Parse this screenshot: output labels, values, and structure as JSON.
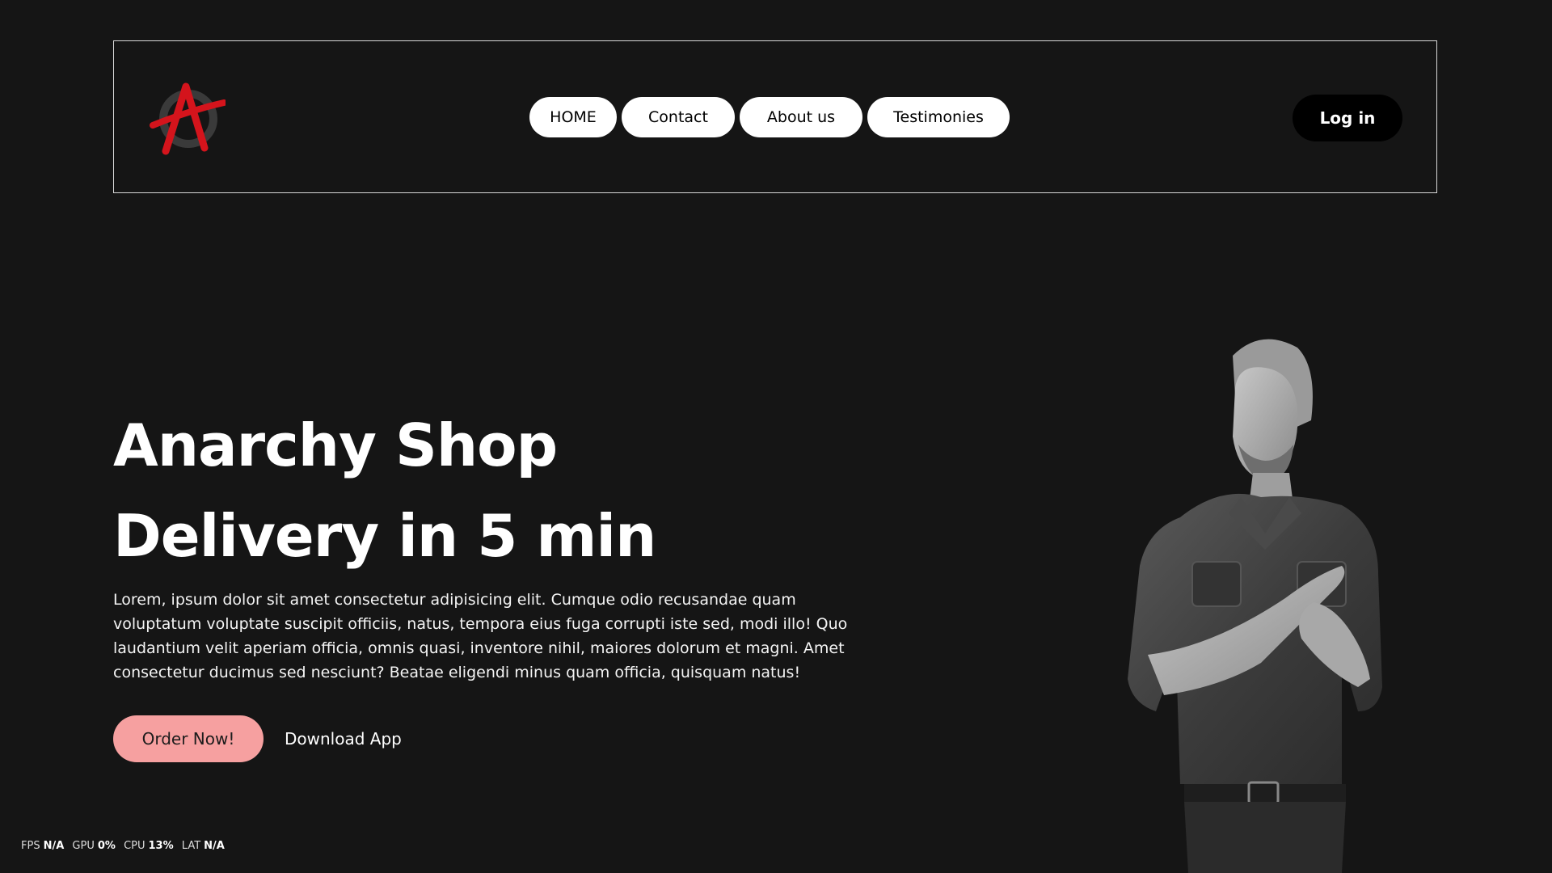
{
  "header": {
    "logo_icon": "anarchy-a-icon",
    "nav": {
      "home": "HOME",
      "contact": "Contact",
      "about": "About us",
      "testimonies": "Testimonies"
    },
    "login_label": "Log in"
  },
  "hero": {
    "title_line1": "Anarchy Shop",
    "title_line2": "Delivery in 5 min",
    "description": "Lorem, ipsum dolor sit amet consectetur adipisicing elit. Cumque odio recusandae quam voluptatum voluptate suscipit officiis, natus, tempora eius fuga corrupti iste sed, modi illo! Quo laudantium velit aperiam officia, omnis quasi, inventore nihil, maiores dolorum et magni. Amet consectetur ducimus sed nesciunt? Beatae eligendi minus quam officia, quisquam natus!",
    "order_label": "Order Now!",
    "download_label": "Download App",
    "image": "man-in-denim-shirt-photo"
  },
  "perf_overlay": {
    "fps_label": "FPS",
    "fps_value": "N/A",
    "gpu_label": "GPU",
    "gpu_value": "0%",
    "cpu_label": "CPU",
    "cpu_value": "13%",
    "lat_label": "LAT",
    "lat_value": "N/A"
  },
  "colors": {
    "background": "#151515",
    "accent_logo": "#d4141c",
    "order_button": "#f6a0a0"
  }
}
